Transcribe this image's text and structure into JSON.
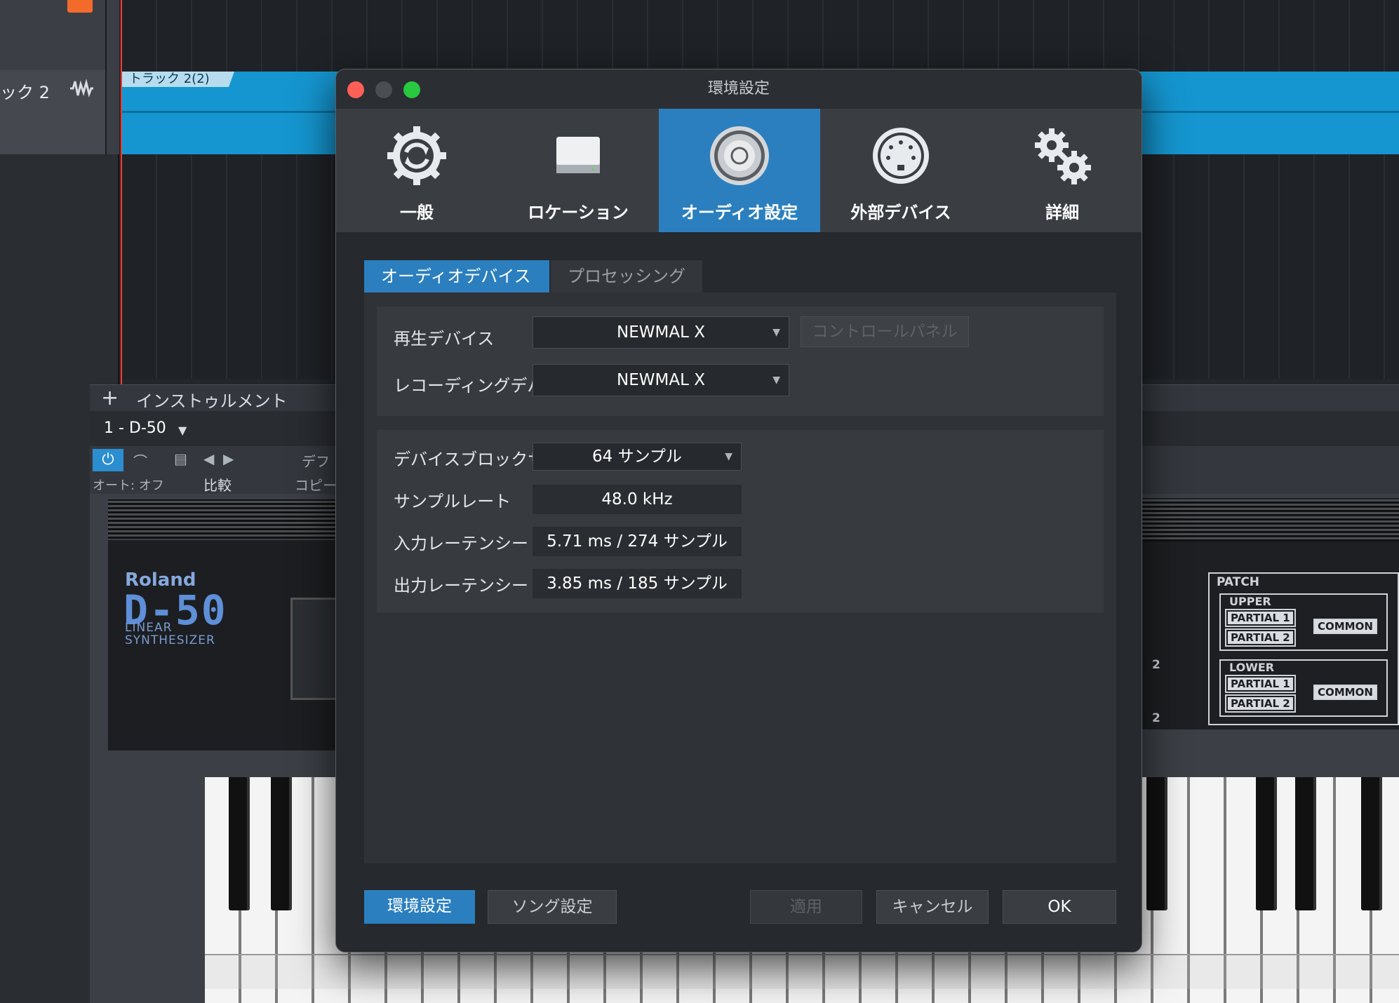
{
  "background": {
    "track_name": "ック 2",
    "clip_label": "トラック 2(2)",
    "instrument_panel": {
      "plus": "+",
      "title": "インストゥルメント",
      "instrument_name": "1 - D-50",
      "dropdown_arrow": "▼",
      "power": "⏻",
      "auto_off": "オート: オフ",
      "compare": "比較",
      "default": "デフ",
      "copy": "コピー",
      "nav_prev": "◀",
      "nav_next": "▶"
    },
    "synth": {
      "brand": "Roland",
      "model": "D-50",
      "subtitle_line1": "LINEAR",
      "subtitle_line2": "SYNTHESIZER",
      "patch": "PATCH",
      "upper": "UPPER",
      "lower": "LOWER",
      "partial1": "PARTIAL 1",
      "partial2": "PARTIAL 2",
      "common": "COMMON",
      "num_2": "2"
    }
  },
  "dialog": {
    "title": "環境設定",
    "toolbar": [
      {
        "label": "一般",
        "icon": "gear-sync-icon"
      },
      {
        "label": "ロケーション",
        "icon": "drive-icon"
      },
      {
        "label": "オーディオ設定",
        "icon": "speaker-icon",
        "active": true
      },
      {
        "label": "外部デバイス",
        "icon": "midi-port-icon"
      },
      {
        "label": "詳細",
        "icon": "gears-icon"
      }
    ],
    "subtabs": {
      "audio_device": "オーディオデバイス",
      "processing": "プロセッシング"
    },
    "settings": {
      "playback_label": "再生デバイス",
      "playback_value": "NEWMAL X",
      "control_panel": "コントロールパネル",
      "recording_label": "レコーディングデバイ",
      "recording_value": "NEWMAL X",
      "block_size_label": "デバイスブロックサイ",
      "block_size_value": "64 サンプル",
      "sample_rate_label": "サンプルレート",
      "sample_rate_value": "48.0 kHz",
      "input_latency_label": "入力レーテンシー",
      "input_latency_value": "5.71 ms / 274 サンプル",
      "output_latency_label": "出力レーテンシー",
      "output_latency_value": "3.85 ms / 185 サンプル"
    },
    "footer": {
      "preferences": "環境設定",
      "song_settings": "ソング設定",
      "apply": "適用",
      "cancel": "キャンセル",
      "ok": "OK"
    }
  },
  "colors": {
    "accent": "#2b7fbe",
    "clip": "#1596d0",
    "close": "#fe5f57",
    "zoom": "#28c840"
  }
}
